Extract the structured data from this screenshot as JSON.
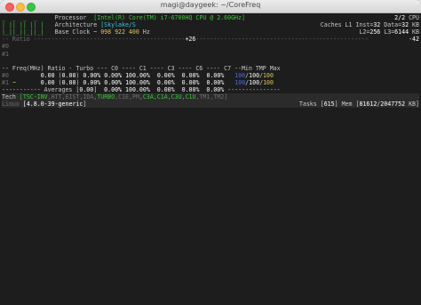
{
  "window": {
    "title": "magi@daygeek: ~/CoreFreq"
  },
  "logo": [
    "_  _  _  _",
    "| || || || |",
    "|_||_||_||_|"
  ],
  "processor": {
    "label": "Processor",
    "value": "[Intel(R) Core(TM) i7-6700HQ CPU @ 2.60GHz]",
    "threads": "2/2",
    "threads_unit": "CPU"
  },
  "architecture": {
    "label": "Architecture",
    "value": "[Skylake/S",
    "caches_label": "Caches L1 Inst=",
    "l1_inst": "32",
    "data_label": "Data=",
    "l1_data": "32",
    "unit": "KB"
  },
  "base_clock": {
    "label": "Base Clock ~",
    "value": "098 922 400",
    "unit": "Hz",
    "l2_label": "L2=",
    "l2": "256",
    "l3_label": "L3=",
    "l3": "6144",
    "l23_unit": "KB"
  },
  "ratio_bar": {
    "left": "-- Ratio --",
    "mark": "+26",
    "right": "-42"
  },
  "cores_top": [
    "#0",
    "#1"
  ],
  "columns": "-- Freq(MHz) Ratio - Turbo --- C0 ---- C1 ---- C3 ---- C6 ---- C7 --Min TMP Max",
  "rows": [
    {
      "id": "#0",
      "freq": "0.00",
      "ratio": "0.00",
      "turbo": "0.00%",
      "c0": "0.00%",
      "c1": "100.00%",
      "c3": "0.00%",
      "c6": "0.00%",
      "c7": "0.00%",
      "min": "100",
      "tmp": "100",
      "max": "100"
    },
    {
      "id": "#1",
      "marker": "~",
      "freq": "0.00",
      "ratio": "0.00",
      "turbo": "0.00%",
      "c0": "0.00%",
      "c1": "100.00%",
      "c3": "0.00%",
      "c6": "0.00%",
      "c7": "0.00%",
      "min": "100",
      "tmp": "100",
      "max": "100"
    }
  ],
  "averages": {
    "label": "----------- Averages [",
    "close": "]",
    "freq": "0.00",
    "c0": "0.00%",
    "c1": "100.00%",
    "c3": "0.00%",
    "c6": "0.00%",
    "c7": "0.00%"
  },
  "tech": {
    "label": "Tech",
    "items": [
      {
        "text": "[TSC-INV",
        "on": true
      },
      {
        "text": ",HTT",
        "on": false
      },
      {
        "text": ",EIST",
        "on": false
      },
      {
        "text": ",IDA",
        "on": false
      },
      {
        "text": ",TURBO",
        "on": true
      },
      {
        "text": ",C1E",
        "on": false
      },
      {
        "text": ",PM",
        "on": false
      },
      {
        "text": ",C3A",
        "on": true
      },
      {
        "text": ",C1A",
        "on": true
      },
      {
        "text": ",C3U",
        "on": true
      },
      {
        "text": ",C1U",
        "on": true
      },
      {
        "text": ",TM1",
        "on": false
      },
      {
        "text": ",TM2]",
        "on": false
      }
    ]
  },
  "linux": {
    "label": "Linux",
    "version": "[4.8.0-39-generic",
    "close": "]"
  },
  "stats": {
    "tasks_label": "Tasks",
    "tasks": "615",
    "mem_label": "Mem",
    "mem_used": "81612",
    "mem_total": "2047752",
    "mem_unit": "KB"
  },
  "colors": {
    "green": "#3ec43e",
    "yellow": "#e3c54d",
    "blue": "#4a6de0",
    "cyan": "#37c6d8",
    "background": "#1d1d1d"
  }
}
